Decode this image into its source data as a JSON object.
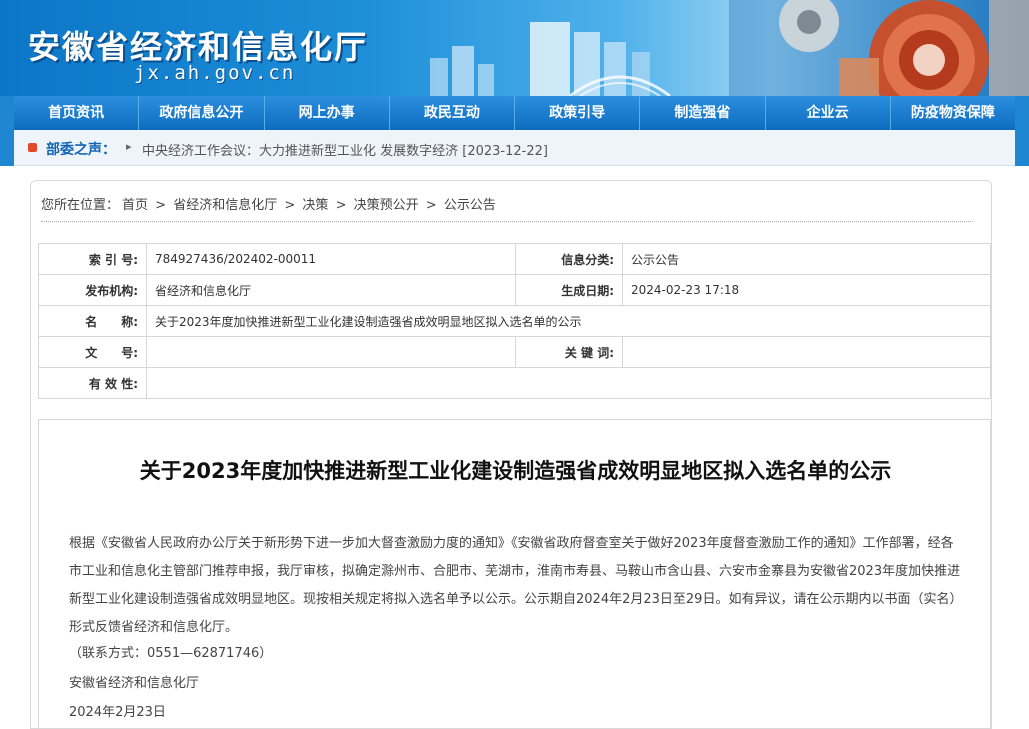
{
  "site": {
    "title": "安徽省经济和信息化厅",
    "domain": "jx.ah.gov.cn"
  },
  "nav": {
    "items": [
      "首页资讯",
      "政府信息公开",
      "网上办事",
      "政民互动",
      "政策引导",
      "制造强省",
      "企业云",
      "防疫物资保障"
    ]
  },
  "ticker": {
    "label": "部委之声：",
    "news": "中央经济工作会议：大力推进新型工业化 发展数字经济 [2023-12-22]"
  },
  "breadcrumb": {
    "prefix": "您所在位置：",
    "items": [
      "首页",
      "省经济和信息化厅",
      "决策",
      "决策预公开",
      "公示公告"
    ],
    "sep": ">"
  },
  "meta": {
    "index_label": "索 引 号:",
    "index_value": "784927436/202402-00011",
    "category_label": "信息分类:",
    "category_value": "公示公告",
    "publisher_label": "发布机构:",
    "publisher_value": "省经济和信息化厅",
    "date_label": "生成日期:",
    "date_value": "2024-02-23 17:18",
    "name_label": "名　　称:",
    "name_value": "关于2023年度加快推进新型工业化建设制造强省成效明显地区拟入选名单的公示",
    "docno_label": "文　　号:",
    "docno_value": "",
    "keywords_label": "关 键 词:",
    "keywords_value": "",
    "validity_label": "有 效 性:",
    "validity_value": ""
  },
  "article": {
    "title": "关于2023年度加快推进新型工业化建设制造强省成效明显地区拟入选名单的公示",
    "paragraph": "根据《安徽省人民政府办公厅关于新形势下进一步加大督查激励力度的通知》《安徽省政府督查室关于做好2023年度督查激励工作的通知》工作部署，经各市工业和信息化主管部门推荐申报，我厅审核，拟确定滁州市、合肥市、芜湖市，淮南市寿县、马鞍山市含山县、六安市金寨县为安徽省2023年度加快推进新型工业化建设制造强省成效明显地区。现按相关规定将拟入选名单予以公示。公示期自2024年2月23日至29日。如有异议，请在公示期内以书面（实名）形式反馈省经济和信息化厅。",
    "contact": "（联系方式：0551—62871746）",
    "signature": "安徽省经济和信息化厅",
    "date": "2024年2月23日"
  }
}
